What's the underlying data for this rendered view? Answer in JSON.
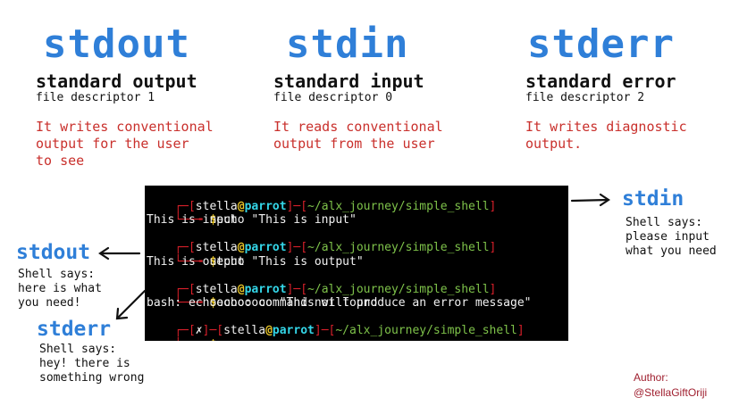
{
  "columns": [
    {
      "title": "stdout",
      "subtitle": "standard output",
      "descriptor": "file descriptor 1",
      "description": "It writes conventional\noutput for the user\nto see"
    },
    {
      "title": "stdin",
      "subtitle": "standard input",
      "descriptor": "file descriptor 0",
      "description": "It reads conventional\noutput from the user"
    },
    {
      "title": "stderr",
      "subtitle": "standard error",
      "descriptor": "file descriptor 2",
      "description": "It writes diagnostic\noutput."
    }
  ],
  "terminal": {
    "user": "stella",
    "at": "@",
    "host": "parrot",
    "path": "~/alx_journey/simple_shell",
    "prompt": "$",
    "x_mark": "✗",
    "commands": [
      "echo \"This is input\"",
      "echo \"This is output\"",
      "echooooo \"This will produce an error message\""
    ],
    "outputs": [
      "This is input",
      "This is output",
      "bash: echooooo: command not found"
    ]
  },
  "callouts": {
    "stdin": {
      "title": "stdin",
      "text": "Shell says:\nplease input\nwhat you need"
    },
    "stdout": {
      "title": "stdout",
      "text": "Shell says:\nhere is what\nyou need!"
    },
    "stderr": {
      "title": "stderr",
      "text": "Shell says:\nhey! there is\nsomething wrong"
    }
  },
  "author": {
    "label": "Author:",
    "handle": "@StellaGiftOriji"
  },
  "colors": {
    "title_blue": "#2f7fd8",
    "description_red": "#c9302c",
    "terminal_bg": "#000000",
    "prompt_red": "#d8202a",
    "host_cyan": "#34d6e8",
    "path_green": "#7ec24a",
    "dollar_yellow": "#e9c628"
  }
}
